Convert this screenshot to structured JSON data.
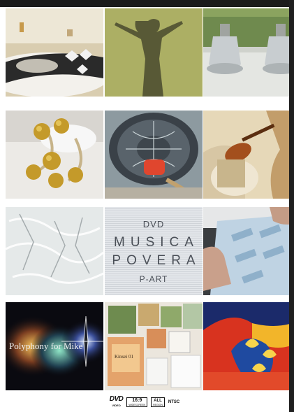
{
  "cover": {
    "title_block": {
      "line1": "DVD",
      "line2": "MUSICA",
      "line3": "POVERA",
      "line4": "P-ART"
    },
    "polyphony_caption": "Polyphony for Mike",
    "book_cover_text": "Kinsei 01"
  },
  "footer": {
    "dvd_logo": "DVD",
    "dvd_logo_sub": "VIDEO",
    "aspect_ratio": "16:9",
    "aspect_sub": "WIDESCREEN",
    "region": "ALL",
    "region_sub": "REGION",
    "format": "NTSC"
  },
  "colors": {
    "background": "#ffffff",
    "frame": "#1f1f1f"
  }
}
